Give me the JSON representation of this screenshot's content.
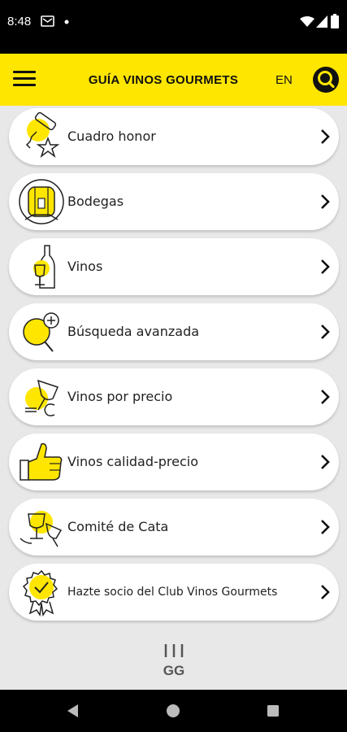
{
  "status": {
    "time": "8:48"
  },
  "appbar": {
    "title": "GUÍA VINOS GOURMETS",
    "lang": "EN",
    "menu_icon": "hamburger-menu-icon",
    "search_icon": "search-icon"
  },
  "menu": {
    "items": [
      {
        "label": "Cuadro honor",
        "icon": "corkscrew-star-icon"
      },
      {
        "label": "Bodegas",
        "icon": "barrel-icon"
      },
      {
        "label": "Vinos",
        "icon": "bottle-glass-icon"
      },
      {
        "label": "Búsqueda avanzada",
        "icon": "magnifier-plus-icon"
      },
      {
        "label": "Vinos por precio",
        "icon": "glass-euro-icon"
      },
      {
        "label": "Vinos calidad-precio",
        "icon": "thumbs-up-icon"
      },
      {
        "label": "Comité de Cata",
        "icon": "tasting-glasses-icon"
      },
      {
        "label": "Hazte socio del Club Vinos Gourmets",
        "icon": "badge-check-icon"
      }
    ]
  },
  "footer": {
    "logo": "GG"
  },
  "colors": {
    "accent": "#ffe600",
    "background": "#e8e8e8",
    "card": "#ffffff",
    "statusbar": "#000000"
  }
}
